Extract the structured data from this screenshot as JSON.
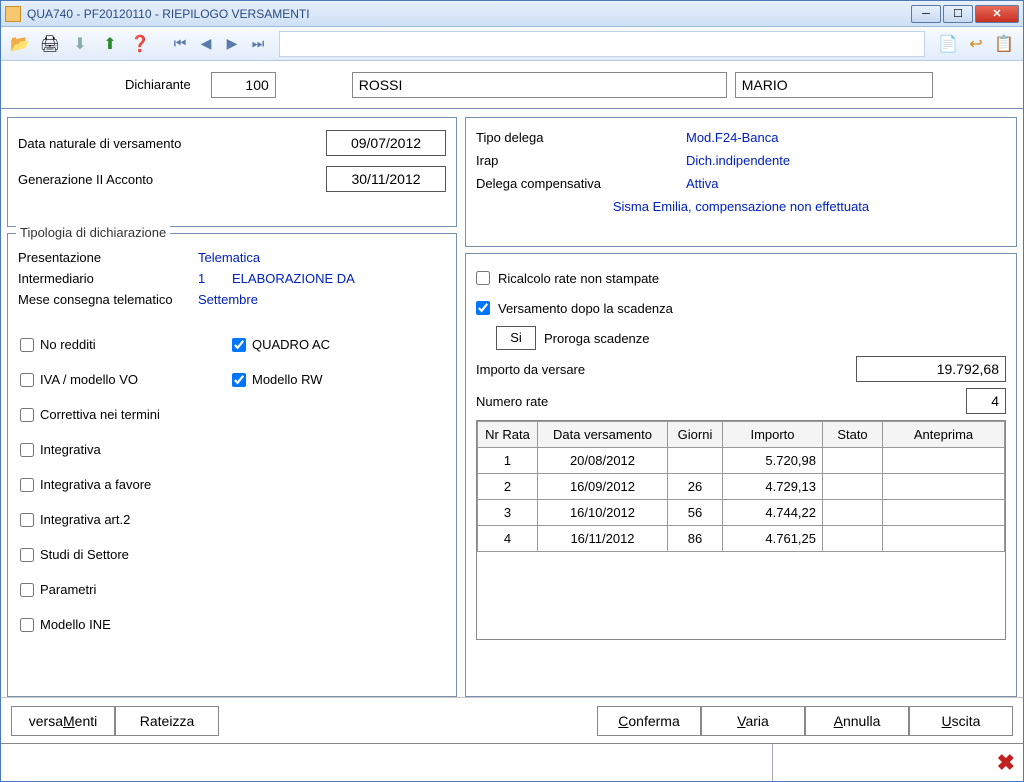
{
  "window": {
    "title": "QUA740  -  PF20120110  -   RIEPILOGO VERSAMENTI"
  },
  "header": {
    "dichiarante_label": "Dichiarante",
    "code": "100",
    "surname": "ROSSI",
    "name": "MARIO"
  },
  "left_panel": {
    "data_naturale_label": "Data naturale di versamento",
    "data_naturale_value": "09/07/2012",
    "gen_acconto_label": "Generazione II Acconto",
    "gen_acconto_value": "30/11/2012"
  },
  "tipologia": {
    "legend": "Tipologia di dichiarazione",
    "presentazione_label": "Presentazione",
    "presentazione_value": "Telematica",
    "intermediario_label": "Intermediario",
    "intermediario_num": "1",
    "intermediario_value": "ELABORAZIONE DA",
    "mese_label": "Mese consegna telematico",
    "mese_value": "Settembre"
  },
  "left_checks": {
    "no_redditi": "No redditi",
    "quadro_ac": "QUADRO AC",
    "iva_vo": "IVA / modello VO",
    "modello_rw": "Modello RW",
    "correttiva": "Correttiva nei termini",
    "integrativa": "Integrativa",
    "integrativa_fav": "Integrativa a favore",
    "integrativa_art2": "Integrativa art.2",
    "studi": "Studi di Settore",
    "parametri": "Parametri",
    "modello_ine": "Modello INE"
  },
  "right_top": {
    "tipo_delega_label": "Tipo delega",
    "tipo_delega_value": "Mod.F24-Banca",
    "irap_label": "Irap",
    "irap_value": "Dich.indipendente",
    "delega_comp_label": "Delega compensativa",
    "delega_comp_value": "Attiva",
    "sisma": "Sisma Emilia, compensazione non effettuata"
  },
  "right_opts": {
    "ricalcolo": "Ricalcolo rate non stampate",
    "versamento_scad": "Versamento dopo la scadenza",
    "si": "Si",
    "proroga": "Proroga scadenze",
    "importo_label": "Importo da versare",
    "importo_value": "19.792,68",
    "numero_rate_label": "Numero rate",
    "numero_rate_value": "4"
  },
  "table": {
    "headers": {
      "nr": "Nr Rata",
      "data": "Data versamento",
      "giorni": "Giorni",
      "importo": "Importo",
      "stato": "Stato",
      "anteprima": "Anteprima"
    },
    "rows": [
      {
        "nr": "1",
        "data": "20/08/2012",
        "giorni": "",
        "importo": "5.720,98",
        "stato": "",
        "anteprima": ""
      },
      {
        "nr": "2",
        "data": "16/09/2012",
        "giorni": "26",
        "importo": "4.729,13",
        "stato": "",
        "anteprima": ""
      },
      {
        "nr": "3",
        "data": "16/10/2012",
        "giorni": "56",
        "importo": "4.744,22",
        "stato": "",
        "anteprima": ""
      },
      {
        "nr": "4",
        "data": "16/11/2012",
        "giorni": "86",
        "importo": "4.761,25",
        "stato": "",
        "anteprima": ""
      }
    ]
  },
  "footer": {
    "versamenti": "versaMenti",
    "rateizza": "Rateizza",
    "conferma": "Conferma",
    "varia": "Varia",
    "annulla": "Annulla",
    "uscita": "Uscita"
  }
}
